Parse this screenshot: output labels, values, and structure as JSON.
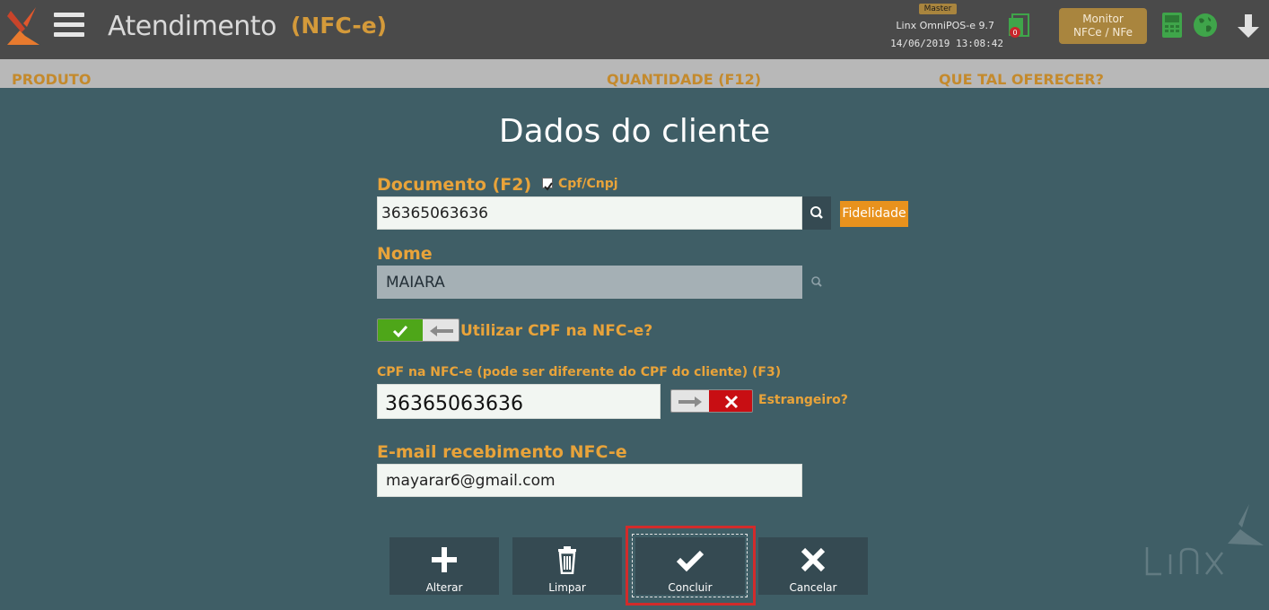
{
  "header": {
    "title": "Atendimento",
    "subtitle": "(NFC-e)",
    "badge": "Master",
    "version": "Linx OmniPOS-e  9.7",
    "datetime": "14/06/2019 13:08:42",
    "monitor_button": {
      "line1": "Monitor",
      "line2": "NFCe / NFe"
    },
    "icons": [
      "app-logo-icon",
      "hamburger-menu-icon",
      "document-alert-icon",
      "pos-terminal-icon",
      "globe-icon",
      "download-arrow-icon"
    ],
    "doc_badge_count": "0",
    "accent_color": "#d49a3a"
  },
  "columns": {
    "produto": "PRODUTO",
    "quantidade": "QUANTIDADE (F12)",
    "oferecer": "QUE TAL OFERECER?"
  },
  "dialog": {
    "title": "Dados do cliente",
    "documento": {
      "label": "Documento (F2)",
      "checkbox_label": "Cpf/Cnpj",
      "checkbox_checked": true,
      "value": "36365063636",
      "fidelidade_label": "Fidelidade"
    },
    "nome": {
      "label": "Nome",
      "value": "MAIARA"
    },
    "usar_cpf": {
      "label": "Utilizar CPF na NFC-e?",
      "enabled": true
    },
    "cpf_nfce": {
      "label": "CPF na NFC-e (pode ser diferente do CPF do cliente) (F3)",
      "value": "36365063636",
      "estrangeiro_label": "Estrangeiro?",
      "estrangeiro_enabled": false
    },
    "email": {
      "label": "E-mail recebimento NFC-e",
      "value": "mayarar6@gmail.com"
    }
  },
  "actions": {
    "alterar": "Alterar",
    "limpar": "Limpar",
    "concluir": "Concluir",
    "cancelar": "Cancelar"
  },
  "colors": {
    "background": "#3f5e66",
    "topbar": "#4a4a4a",
    "label": "#e8a33a",
    "button": "#354a52",
    "fidelidade": "#e8921d",
    "focus": "#d22b2b"
  }
}
